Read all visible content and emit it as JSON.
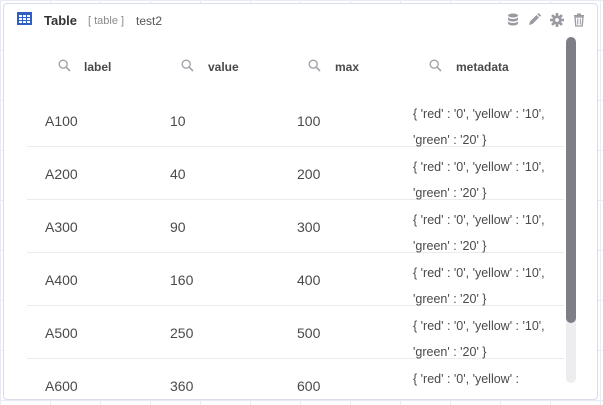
{
  "widget": {
    "title": "Table",
    "type_tag": "[ table ]",
    "name": "test2",
    "accent": "#2f5fc4",
    "header_icons": [
      "database-icon",
      "pencil-icon",
      "gear-icon",
      "trash-icon"
    ]
  },
  "table": {
    "columns": [
      "label",
      "value",
      "max",
      "metadata"
    ],
    "rows": [
      {
        "label": "A100",
        "value": "10",
        "max": "100",
        "metadata": "{ 'red' : '0', 'yellow' : '10', 'green' : '20' }"
      },
      {
        "label": "A200",
        "value": "40",
        "max": "200",
        "metadata": "{ 'red' : '0', 'yellow' : '10', 'green' : '20' }"
      },
      {
        "label": "A300",
        "value": "90",
        "max": "300",
        "metadata": "{ 'red' : '0', 'yellow' : '10', 'green' : '20' }"
      },
      {
        "label": "A400",
        "value": "160",
        "max": "400",
        "metadata": "{ 'red' : '0', 'yellow' : '10', 'green' : '20' }"
      },
      {
        "label": "A500",
        "value": "250",
        "max": "500",
        "metadata": "{ 'red' : '0', 'yellow' : '10', 'green' : '20' }"
      },
      {
        "label": "A600",
        "value": "360",
        "max": "600",
        "metadata": "{ 'red' : '0', 'yellow' :"
      }
    ]
  }
}
